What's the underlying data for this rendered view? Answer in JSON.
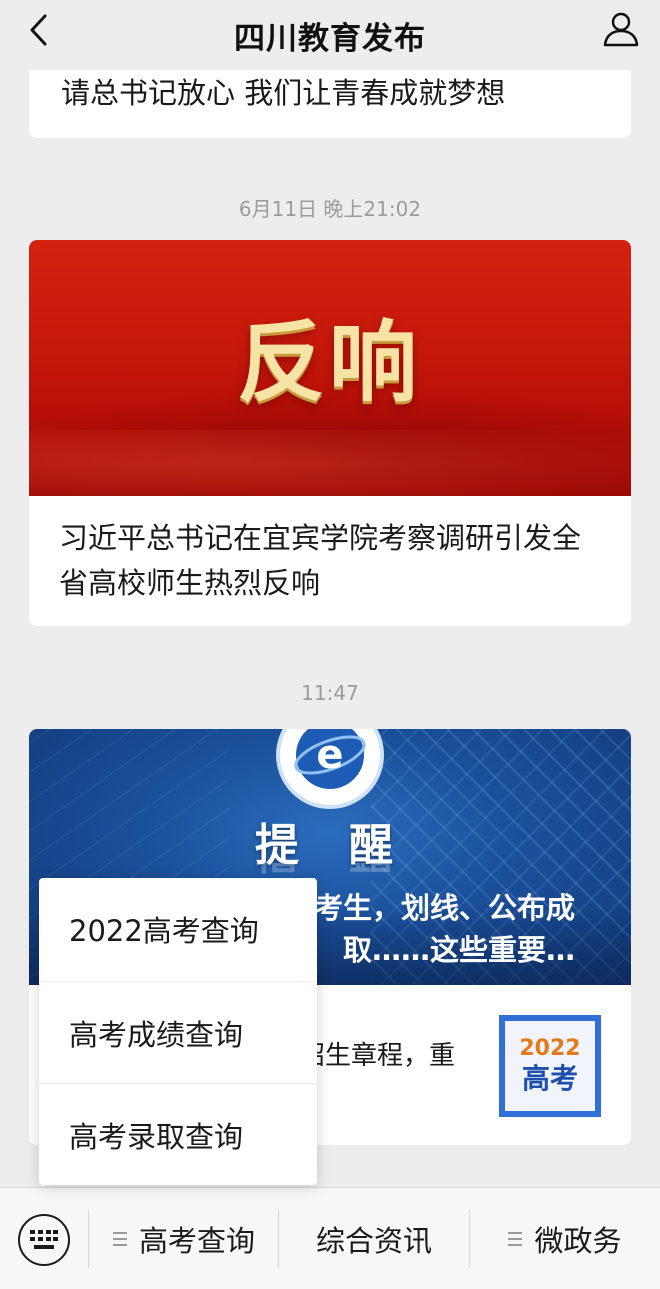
{
  "header": {
    "title": "四川教育发布",
    "back_icon": "chevron-left-icon",
    "profile_icon": "person-icon"
  },
  "feed": {
    "prev_article_title": "请总书记放心 我们让青春成就梦想",
    "timestamp_1": "6月11日 晚上21:02",
    "article_1": {
      "banner_text": "反响",
      "title": "习近平总书记在宜宾学院考察调研引发全省高校师生热烈反响"
    },
    "timestamp_2": "11:47",
    "article_2": {
      "banner_logo": "e",
      "banner_heading": "提醒",
      "banner_subtitle": "考生，划线、公布成 取……这些重要…",
      "banner_sub_line1": "考生，划线、公布成",
      "banner_sub_line2": "取……这些重要…",
      "sub_item_text": "招生章程，重",
      "thumb_year": "2022",
      "thumb_label": "高考"
    }
  },
  "popup_menu": {
    "items": [
      "2022高考查询",
      "高考成绩查询",
      "高考录取查询"
    ]
  },
  "bottom_menu": {
    "keyboard_icon": "keyboard-icon",
    "items": [
      "高考查询",
      "综合资讯",
      "微政务"
    ]
  },
  "colors": {
    "background": "#ededed",
    "banner_red": "#c5170b",
    "banner_gold_text": "#f8e3a6",
    "banner_blue": "#1a4f9a"
  }
}
